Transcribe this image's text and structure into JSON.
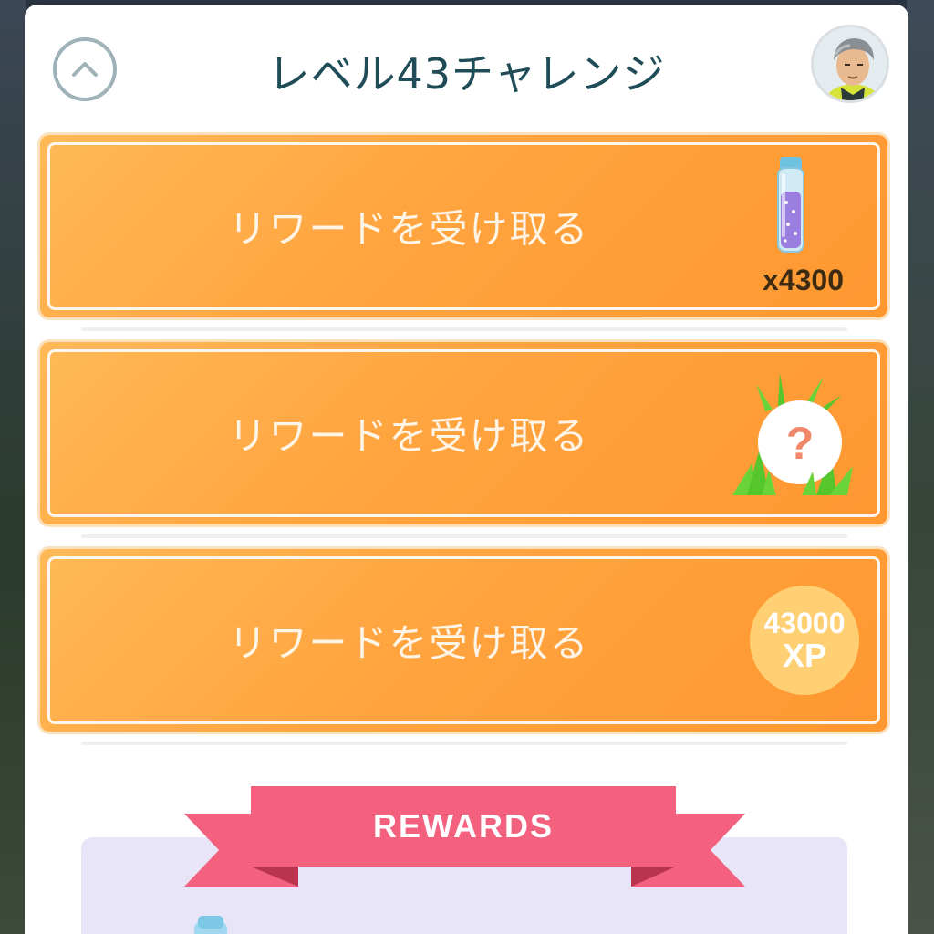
{
  "header": {
    "title": "レベル43チャレンジ",
    "collapse_icon": "chevron-up-icon",
    "avatar_icon": "trainer-avatar"
  },
  "rewards_list": [
    {
      "label": "リワードを受け取る",
      "item_icon": "stardust-vial-icon",
      "quantity": "x4300"
    },
    {
      "label": "リワードを受け取る",
      "item_icon": "mystery-encounter-icon",
      "mystery_mark": "?"
    },
    {
      "label": "リワードを受け取る",
      "xp_amount": "43000",
      "xp_unit": "XP"
    }
  ],
  "rewards_banner": {
    "label": "REWARDS"
  },
  "colors": {
    "card_orange": "#ffa43f",
    "title_teal": "#1f4c57",
    "ribbon_pink": "#f3617f",
    "rewards_bg": "#e8e5f8"
  }
}
